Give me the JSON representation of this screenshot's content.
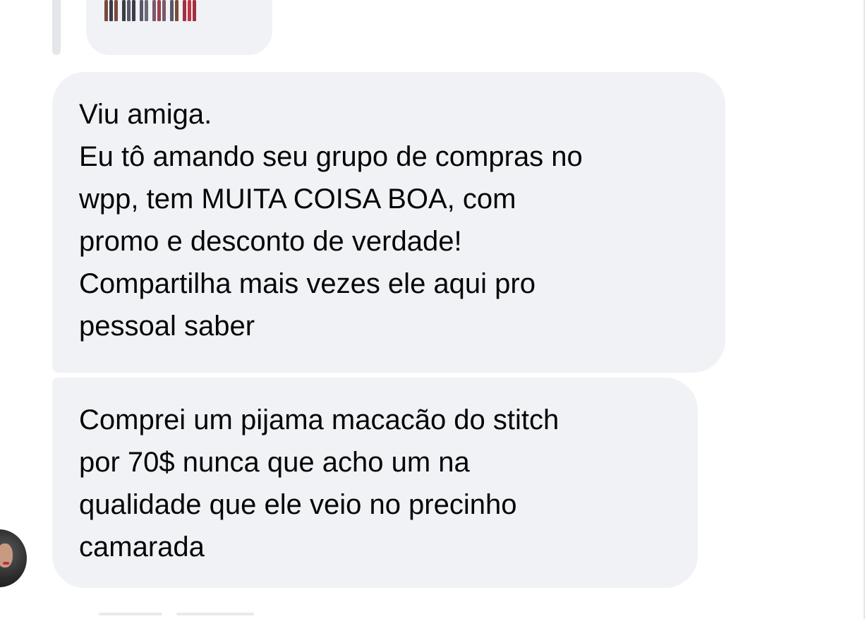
{
  "conversation": {
    "previous_attachment": {
      "icon": "sticker-image-icon",
      "figure_colors": [
        "#7a4a3a",
        "#3c3c46",
        "#585868",
        "#7a5a6a",
        "#a03040",
        "#c03545"
      ]
    },
    "messages": [
      {
        "lines": [
          "Viu amiga.",
          "Eu tô amando seu grupo de compras no",
          "wpp, tem MUITA COISA BOA, com",
          "promo e desconto de verdade!",
          "Compartilha mais vezes ele aqui pro",
          "pessoal saber"
        ]
      },
      {
        "lines": [
          "Comprei um pijama macacão do stitch",
          "por 70$ nunca que acho um na",
          "qualidade que ele veio no precinho",
          "camarada"
        ]
      }
    ],
    "sender_avatar": {
      "icon": "user-avatar-icon"
    }
  },
  "colors": {
    "bubble_background": "#f0f2f5",
    "text": "#050505",
    "page_background": "#ffffff"
  }
}
